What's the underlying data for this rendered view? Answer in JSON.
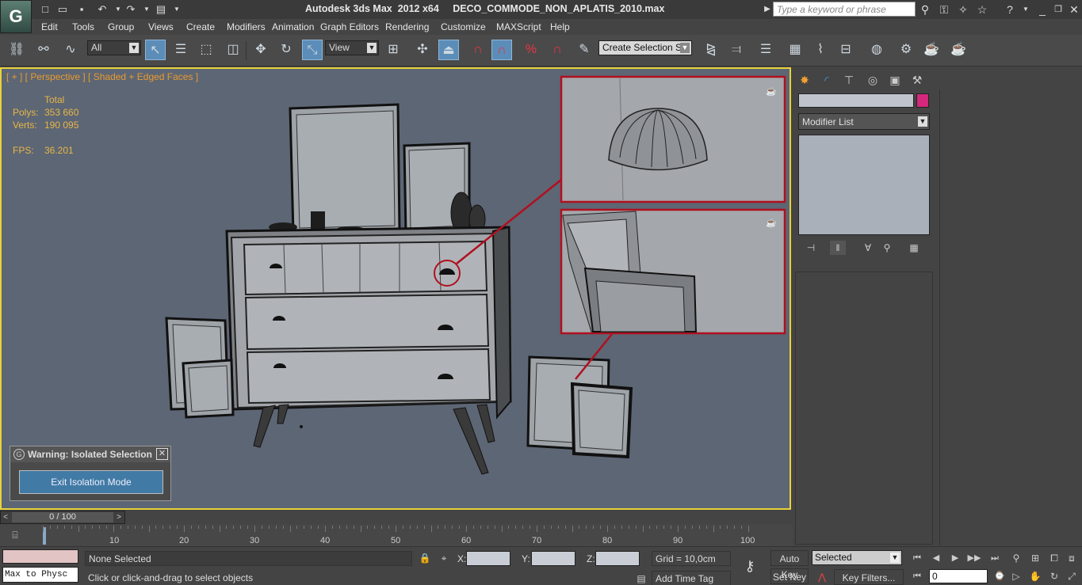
{
  "title_bar": {
    "title": "Autodesk 3ds Max  2012 x64     DECO_COMMODE_NON_APLATIS_2010.max",
    "search_placeholder": "Type a keyword or phrase",
    "app_logo": "G"
  },
  "menu": [
    "Edit",
    "Tools",
    "Group",
    "Views",
    "Create",
    "Modifiers",
    "Animation",
    "Graph Editors",
    "Rendering",
    "Customize",
    "MAXScript",
    "Help"
  ],
  "toolbar": {
    "selection_filter": "All",
    "reference_coord": "View",
    "named_selection": "Create Selection Se"
  },
  "viewport": {
    "label": "[ + ] [ Perspective ] [ Shaded + Edged Faces ]",
    "stats": {
      "total_label": "Total",
      "polys_label": "Polys:",
      "polys_value": "353 660",
      "verts_label": "Verts:",
      "verts_value": "190 095",
      "fps_label": "FPS:",
      "fps_value": "36.201"
    }
  },
  "warning": {
    "title": "Warning: Isolated Selection",
    "button": "Exit Isolation Mode",
    "close": "✕"
  },
  "command_panel": {
    "modifier_list": "Modifier List",
    "object_color": "#d4287c"
  },
  "timeline": {
    "value": "0 / 100",
    "ticks": [
      "10",
      "20",
      "30",
      "40",
      "50",
      "60",
      "70",
      "80",
      "90",
      "100"
    ]
  },
  "status": {
    "selection": "None Selected",
    "prompt": "Click or click-and-drag to select objects",
    "x_label": "X:",
    "y_label": "Y:",
    "z_label": "Z:",
    "grid": "Grid = 10,0cm",
    "add_time_tag": "Add Time Tag",
    "auto_key": "Auto Key",
    "set_key": "Set Key",
    "selected_dropdown": "Selected",
    "key_filters": "Key Filters...",
    "frame": "0",
    "mini_listener": "Max to Physc"
  },
  "colors": {
    "viewport_bg": "#5d6674",
    "viewport_border": "#e8d23a",
    "label_orange": "#e89a2f",
    "stat_yellow": "#e8b648",
    "callout_red": "#b01020",
    "exit_button": "#417ba5"
  }
}
